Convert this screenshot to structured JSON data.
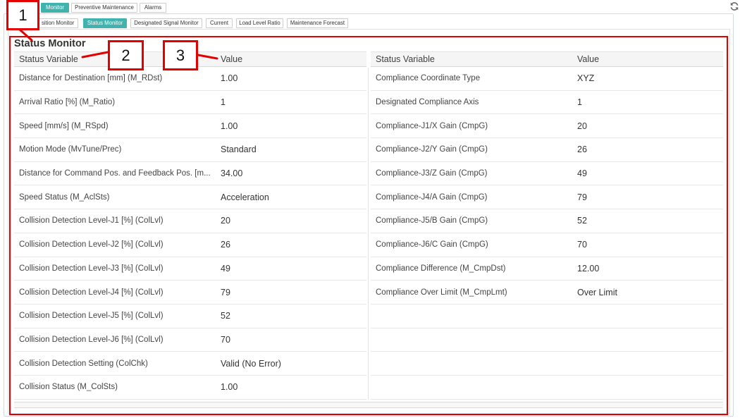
{
  "top_tabs": [
    {
      "label": "Monitor",
      "active": true
    },
    {
      "label": "Preventive Maintenance",
      "active": false
    },
    {
      "label": "Alarms",
      "active": false
    }
  ],
  "sub_tabs": [
    {
      "label": "sition Monitor",
      "active": false
    },
    {
      "label": "Status Monitor",
      "active": true
    },
    {
      "label": "Designated Signal Monitor",
      "active": false
    },
    {
      "label": "Current",
      "active": false
    },
    {
      "label": "Load Level Ratio",
      "active": false
    },
    {
      "label": "Maintenance Forecast",
      "active": false
    }
  ],
  "toolbar": {
    "refresh_icon": "refresh-icon"
  },
  "section_title": "Status Monitor",
  "left_table": {
    "headers": {
      "variable": "Status Variable",
      "value": "Value"
    },
    "rows": [
      {
        "variable": "Distance for Destination [mm] (M_RDst)",
        "value": "1.00"
      },
      {
        "variable": "Arrival Ratio [%] (M_Ratio)",
        "value": "1"
      },
      {
        "variable": "Speed [mm/s] (M_RSpd)",
        "value": "1.00"
      },
      {
        "variable": "Motion Mode (MvTune/Prec)",
        "value": "Standard"
      },
      {
        "variable": "Distance for Command Pos. and Feedback Pos. [m...",
        "value": "34.00"
      },
      {
        "variable": "Speed Status (M_AclSts)",
        "value": "Acceleration"
      },
      {
        "variable": "Collision Detection Level-J1 [%] (ColLvl)",
        "value": "20"
      },
      {
        "variable": "Collision Detection Level-J2 [%] (ColLvl)",
        "value": "26"
      },
      {
        "variable": "Collision Detection Level-J3 [%] (ColLvl)",
        "value": "49"
      },
      {
        "variable": "Collision Detection Level-J4 [%] (ColLvl)",
        "value": "79"
      },
      {
        "variable": "Collision Detection Level-J5 [%] (ColLvl)",
        "value": "52"
      },
      {
        "variable": "Collision Detection Level-J6 [%] (ColLvl)",
        "value": "70"
      },
      {
        "variable": "Collision Detection Setting (ColChk)",
        "value": "Valid (No Error)"
      },
      {
        "variable": "Collision Status (M_ColSts)",
        "value": "1.00"
      }
    ]
  },
  "right_table": {
    "headers": {
      "variable": "Status Variable",
      "value": "Value"
    },
    "rows": [
      {
        "variable": "Compliance Coordinate Type",
        "value": "XYZ"
      },
      {
        "variable": "Designated Compliance Axis",
        "value": "1"
      },
      {
        "variable": "Compliance-J1/X Gain (CmpG)",
        "value": "20"
      },
      {
        "variable": "Compliance-J2/Y Gain (CmpG)",
        "value": "26"
      },
      {
        "variable": "Compliance-J3/Z Gain (CmpG)",
        "value": "49"
      },
      {
        "variable": "Compliance-J4/A Gain (CmpG)",
        "value": "79"
      },
      {
        "variable": "Compliance-J5/B Gain (CmpG)",
        "value": "52"
      },
      {
        "variable": "Compliance-J6/C Gain (CmpG)",
        "value": "70"
      },
      {
        "variable": "Compliance Difference (M_CmpDst)",
        "value": "12.00"
      },
      {
        "variable": "Compliance Over Limit (M_CmpLmt)",
        "value": "Over Limit"
      }
    ]
  },
  "annotations": [
    {
      "label": "1"
    },
    {
      "label": "2"
    },
    {
      "label": "3"
    }
  ],
  "colors": {
    "accent": "#40b3ae",
    "annotation": "#e50000"
  }
}
